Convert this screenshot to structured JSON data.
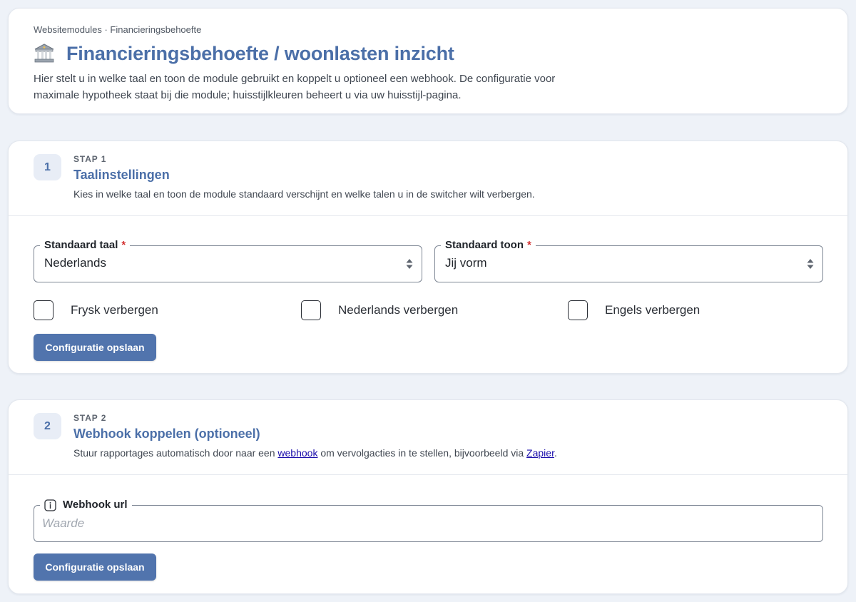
{
  "header": {
    "breadcrumb": "Websitemodules · Financieringsbehoefte",
    "title": "Financieringsbehoefte / woonlasten inzicht",
    "title_icon": "bank-icon",
    "description": "Hier stelt u in welke taal en toon de module gebruikt en koppelt u optioneel een webhook. De configuratie voor maximale hypotheek staat bij die module; huisstijlkleuren beheert u via uw huisstijl-pagina."
  },
  "step1": {
    "number": "1",
    "kicker": "STAP 1",
    "title": "Taalinstellingen",
    "description": "Kies in welke taal en toon de module standaard verschijnt en welke talen u in de switcher wilt verbergen.",
    "language_field": {
      "label": "Standaard taal",
      "required_mark": "*",
      "value": "Nederlands"
    },
    "tone_field": {
      "label": "Standaard toon",
      "required_mark": "*",
      "value": "Jij vorm"
    },
    "checkboxes": [
      {
        "label": "Frysk verbergen",
        "checked": false
      },
      {
        "label": "Nederlands verbergen",
        "checked": false
      },
      {
        "label": "Engels verbergen",
        "checked": false
      }
    ],
    "save_label": "Configuratie opslaan"
  },
  "step2": {
    "number": "2",
    "kicker": "STAP 2",
    "title": "Webhook koppelen (optioneel)",
    "description_prefix": "Stuur rapportages automatisch door naar een ",
    "webhook_link": "webhook",
    "description_middle": " om vervolgacties in te stellen, bijvoorbeeld via ",
    "zapier_link": "Zapier",
    "description_suffix": ".",
    "url_field": {
      "label": "Webhook url",
      "value": "",
      "placeholder": "Waarde"
    },
    "save_label": "Configuratie opslaan"
  },
  "colors": {
    "accent": "#4b6fa8",
    "button": "#5174ad",
    "background": "#eef2f8",
    "required": "#d32f2f",
    "link": "#1a0dab"
  }
}
